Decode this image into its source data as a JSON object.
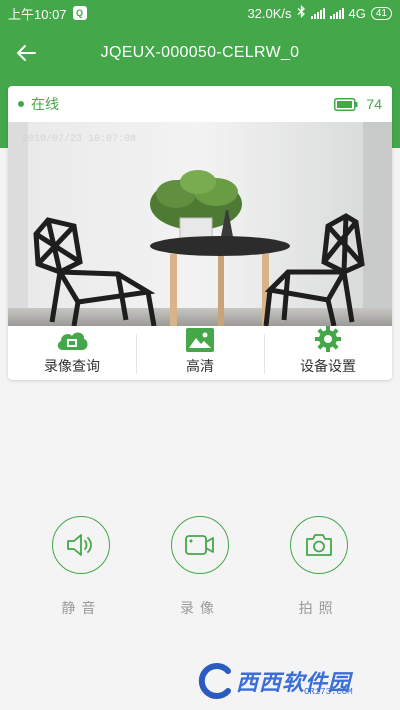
{
  "status_bar": {
    "time": "上午10:07",
    "net_speed": "32.0K/s",
    "network": "4G",
    "battery": "41"
  },
  "header": {
    "title": "JQEUX-000050-CELRW_0"
  },
  "device": {
    "status": "在线",
    "battery_level": "74",
    "timestamp": "2019/07/23 10:07:08"
  },
  "actions": [
    {
      "label": "录像查询",
      "icon": "film-cloud-icon"
    },
    {
      "label": "高清",
      "icon": "image-icon"
    },
    {
      "label": "设备设置",
      "icon": "gear-icon"
    }
  ],
  "controls": [
    {
      "label": "静音",
      "icon": "speaker-icon"
    },
    {
      "label": "录像",
      "icon": "video-camera-icon"
    },
    {
      "label": "拍照",
      "icon": "camera-icon"
    }
  ],
  "watermark": {
    "text": "西西软件园",
    "sub": "CR173.COM"
  },
  "colors": {
    "accent": "#44a84a",
    "background": "#f4f4f4"
  }
}
